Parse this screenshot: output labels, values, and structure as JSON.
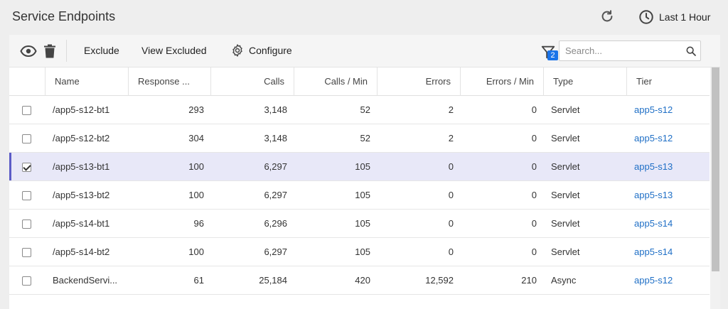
{
  "header": {
    "title": "Service Endpoints",
    "time_range": "Last 1 Hour"
  },
  "toolbar": {
    "exclude_label": "Exclude",
    "view_excluded_label": "View Excluded",
    "configure_label": "Configure",
    "filter_count": "2",
    "search_placeholder": "Search...",
    "search_value": ""
  },
  "icons": {
    "refresh": "refresh-icon",
    "clock": "clock-icon",
    "eye": "eye-icon",
    "trash": "trash-icon",
    "gear": "gear-icon",
    "filter": "filter-icon",
    "search": "search-icon"
  },
  "colors": {
    "link": "#1f6fc6",
    "selected_row": "#e8e8f8",
    "selected_accent": "#5c5cc7",
    "badge": "#1a73e8"
  },
  "table": {
    "columns": [
      "Name",
      "Response ...",
      "Calls",
      "Calls / Min",
      "Errors",
      "Errors / Min",
      "Type",
      "Tier"
    ],
    "rows": [
      {
        "selected": false,
        "cells": [
          "/app5-s12-bt1",
          "293",
          "3,148",
          "52",
          "2",
          "0",
          "Servlet",
          "app5-s12"
        ]
      },
      {
        "selected": false,
        "cells": [
          "/app5-s12-bt2",
          "304",
          "3,148",
          "52",
          "2",
          "0",
          "Servlet",
          "app5-s12"
        ]
      },
      {
        "selected": true,
        "cells": [
          "/app5-s13-bt1",
          "100",
          "6,297",
          "105",
          "0",
          "0",
          "Servlet",
          "app5-s13"
        ]
      },
      {
        "selected": false,
        "cells": [
          "/app5-s13-bt2",
          "100",
          "6,297",
          "105",
          "0",
          "0",
          "Servlet",
          "app5-s13"
        ]
      },
      {
        "selected": false,
        "cells": [
          "/app5-s14-bt1",
          "96",
          "6,296",
          "105",
          "0",
          "0",
          "Servlet",
          "app5-s14"
        ]
      },
      {
        "selected": false,
        "cells": [
          "/app5-s14-bt2",
          "100",
          "6,297",
          "105",
          "0",
          "0",
          "Servlet",
          "app5-s14"
        ]
      },
      {
        "selected": false,
        "cells": [
          "BackendServi...",
          "61",
          "25,184",
          "420",
          "12,592",
          "210",
          "Async",
          "app5-s12"
        ]
      }
    ]
  }
}
